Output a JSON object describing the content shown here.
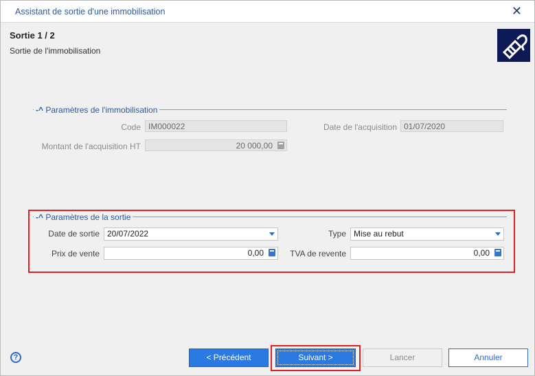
{
  "window": {
    "title": "Assistant de sortie d'une immobilisation",
    "close_glyph": "✕"
  },
  "header": {
    "step": "Sortie 1 / 2",
    "subtitle": "Sortie de l'immobilisation",
    "icon": "wizard-icon"
  },
  "asset_params": {
    "title": "Paramètres de l'immobilisation",
    "code_label": "Code",
    "code_value": "IM000022",
    "acq_date_label": "Date de l'acquisition",
    "acq_date_value": "01/07/2020",
    "amount_label": "Montant de l'acquisition HT",
    "amount_value": "20 000,00"
  },
  "exit_params": {
    "title": "Paramètres de la sortie",
    "date_label": "Date de sortie",
    "date_value": "20/07/2022",
    "type_label": "Type",
    "type_value": "Mise au rebut",
    "price_label": "Prix de vente",
    "price_value": "0,00",
    "vat_label": "TVA de revente",
    "vat_value": "0,00"
  },
  "buttons": {
    "previous": "< Précédent",
    "next": "Suivant >",
    "launch": "Lancer",
    "cancel": "Annuler"
  },
  "help_glyph": "?",
  "colors": {
    "accent": "#2a7ae2",
    "highlight": "#e02020",
    "section": "#2c5a96"
  }
}
